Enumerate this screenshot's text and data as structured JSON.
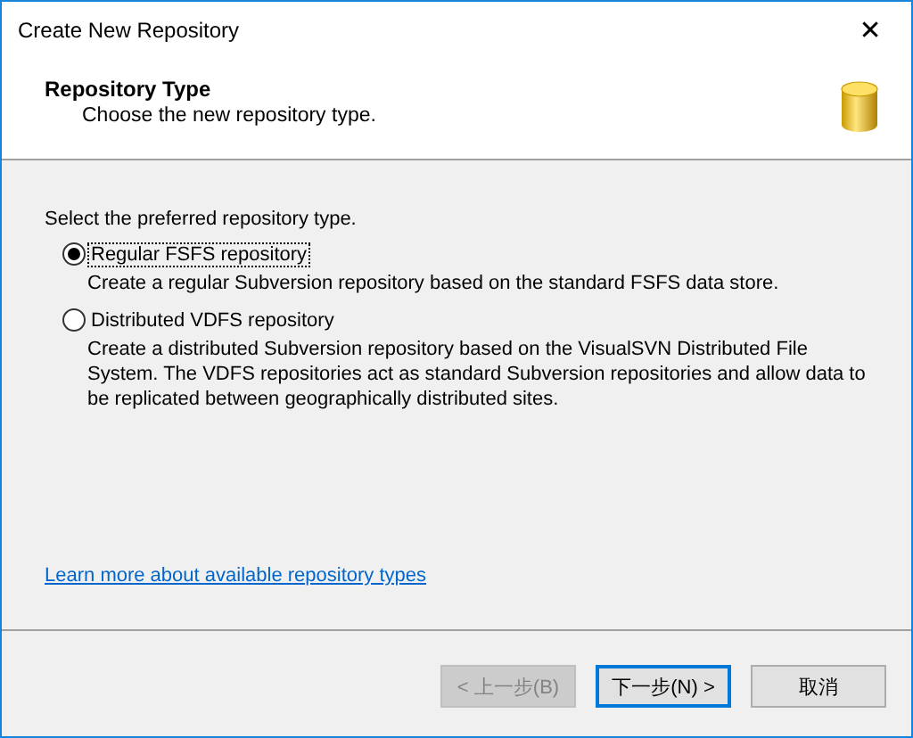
{
  "window": {
    "title": "Create New Repository",
    "close": "✕"
  },
  "header": {
    "title": "Repository Type",
    "subtitle": "Choose the new repository type."
  },
  "prompt": "Select the preferred repository type.",
  "options": [
    {
      "label": "Regular FSFS repository",
      "description": "Create a regular Subversion repository based on the standard FSFS data store.",
      "selected": true
    },
    {
      "label": "Distributed VDFS repository",
      "description": "Create a distributed Subversion repository based on the VisualSVN Distributed File System. The VDFS repositories act as standard Subversion repositories and allow data to be replicated between geographically distributed sites.",
      "selected": false
    }
  ],
  "link": "Learn more about available repository types",
  "buttons": [
    {
      "label": "< 上一步(B)",
      "disabled": true,
      "focused": false
    },
    {
      "label": "下一步(N) >",
      "disabled": false,
      "focused": true
    },
    {
      "label": "取消",
      "disabled": false,
      "focused": false
    }
  ]
}
